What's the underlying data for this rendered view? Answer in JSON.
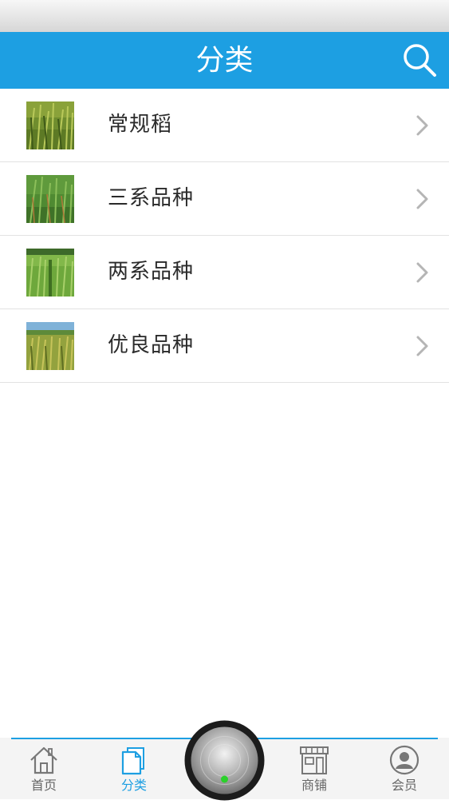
{
  "nav": {
    "title": "分类",
    "search_icon": "search-icon"
  },
  "categories": [
    {
      "label": "常规稻",
      "thumb": "rice-field-photo"
    },
    {
      "label": "三系品种",
      "thumb": "rice-field-photo"
    },
    {
      "label": "两系品种",
      "thumb": "rice-field-photo"
    },
    {
      "label": "优良品种",
      "thumb": "rice-field-photo"
    }
  ],
  "tabbar": {
    "tabs": [
      {
        "label": "首页",
        "icon": "home-icon",
        "active": false
      },
      {
        "label": "分类",
        "icon": "category-icon",
        "active": true
      },
      {
        "label": "商铺",
        "icon": "store-icon",
        "active": false
      },
      {
        "label": "会员",
        "icon": "member-icon",
        "active": false
      }
    ],
    "center": "center-button-icon"
  },
  "colors": {
    "accent": "#1d9fe2",
    "divider": "#e2e2e2",
    "text": "#2a2a2a",
    "tab_text": "#666666",
    "chevron": "#b5b5b5"
  }
}
